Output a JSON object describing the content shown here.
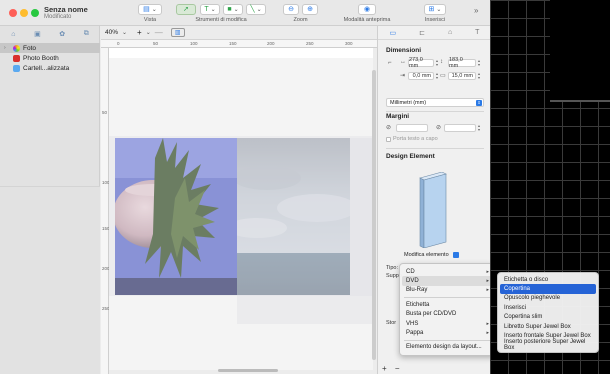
{
  "window": {
    "title": "Senza nome",
    "subtitle": "Modificato"
  },
  "toolbar": {
    "vista": "Vista",
    "strumenti": "Strumenti di modifica",
    "zoom": "Zoom",
    "anteprima": "Modalità anteprima",
    "inserisci": "Inserisci"
  },
  "sidebar": {
    "items": [
      {
        "label": "Foto",
        "icon": "photos-icon"
      },
      {
        "label": "Photo Booth",
        "icon": "photo-booth-icon"
      },
      {
        "label": "Cartell...alizzata",
        "icon": "folder-icon"
      }
    ]
  },
  "canvas": {
    "zoom": "40%",
    "ruler_top": [
      "0",
      "50",
      "100",
      "150",
      "200",
      "250",
      "300"
    ],
    "ruler_left": [
      "50",
      "100",
      "150",
      "200",
      "250"
    ]
  },
  "inspector": {
    "dimensioni": "Dimensioni",
    "width": "273,0 mm",
    "height": "183,0 mm",
    "x": "0,0 mm",
    "y": "15,0 mm",
    "units": "Millimetri (mm)",
    "margini": "Margini",
    "porta_testo": "Porta testo a capo",
    "design_element": "Design Element",
    "modifica": "Modifica elemento",
    "tipo": "Tipo:",
    "supporto": "Suppo",
    "stor": "Stor"
  },
  "menu_main": {
    "items": [
      "CD",
      "DVD",
      "Blu-Ray",
      "Etichetta",
      "Busta per CD/DVD",
      "VHS",
      "Pappa",
      "Elemento design da layout..."
    ]
  },
  "menu_sub": {
    "items": [
      "Etichetta o disco",
      "Copertina",
      "Opuscolo pieghevole",
      "Inserisci",
      "Copertina slim",
      "Libretto Super Jewel Box",
      "Inserto frontale Super Jewel Box",
      "Inserto posteriore Super Jewel Box"
    ]
  },
  "colors": {
    "accent": "#2563d6",
    "selection_green": "#2fa34a"
  }
}
